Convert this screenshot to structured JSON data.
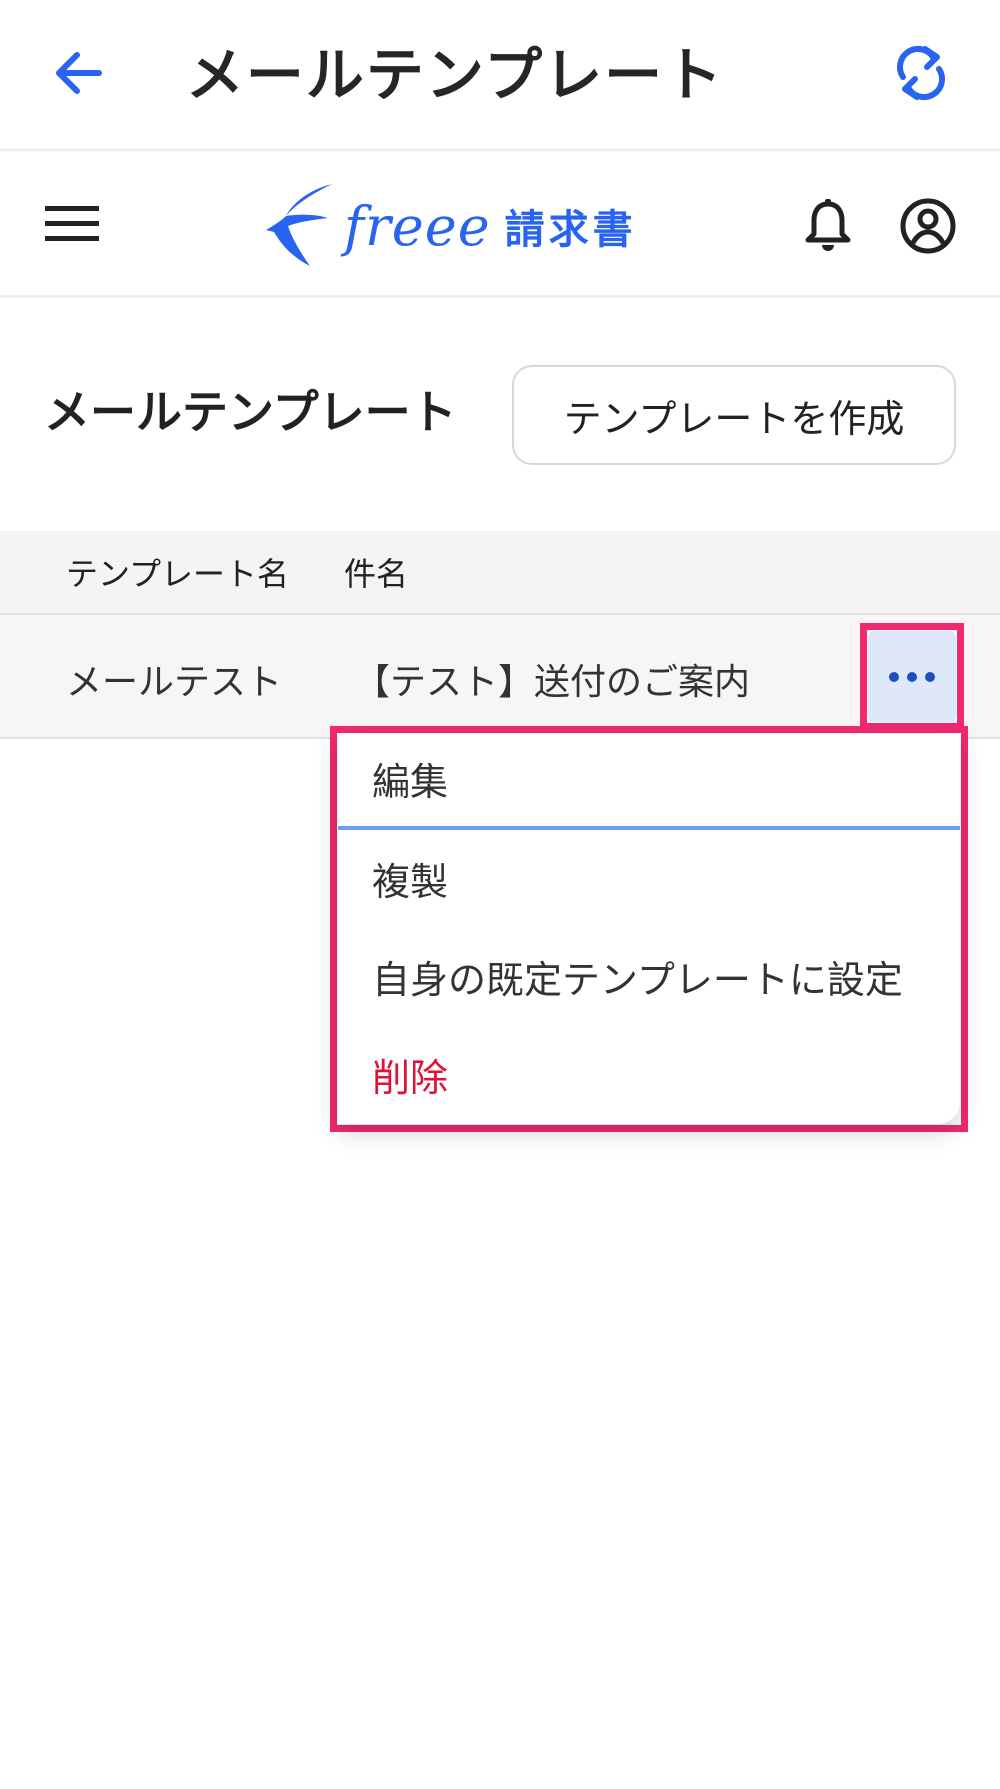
{
  "appbar": {
    "title": "メールテンプレート",
    "back_icon": "arrow-left-icon",
    "refresh_icon": "refresh-icon"
  },
  "header": {
    "menu_icon": "hamburger-menu-icon",
    "logo_brand": "freee",
    "logo_product": "請求書",
    "bell_icon": "bell-icon",
    "account_icon": "account-circle-icon"
  },
  "section": {
    "title": "メールテンプレート",
    "create_button": "テンプレートを作成"
  },
  "table": {
    "columns": [
      "テンプレート名",
      "件名"
    ],
    "rows": [
      {
        "name": "メールテスト",
        "subject": "【テスト】送付のご案内"
      }
    ]
  },
  "dropdown": {
    "items": [
      {
        "label": "編集"
      },
      {
        "label": "複製"
      },
      {
        "label": "自身の既定テンプレートに設定"
      },
      {
        "label": "削除"
      }
    ]
  },
  "colors": {
    "accent": "#2864f0",
    "highlight": "#f2296f",
    "danger": "#dc143c",
    "more_button_bg": "#dfe7fb"
  }
}
